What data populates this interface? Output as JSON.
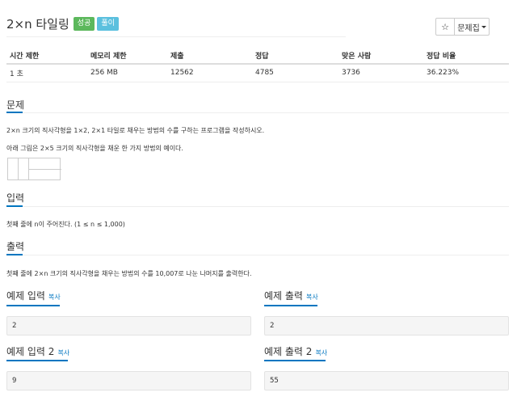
{
  "problem": {
    "title": "2×n 타일링",
    "badges": [
      "성공",
      "풀이"
    ]
  },
  "buttons": {
    "star": "☆",
    "problem_set": "문제집"
  },
  "info_table": {
    "headers": [
      "시간 제한",
      "메모리 제한",
      "제출",
      "정답",
      "맞은 사람",
      "정답 비율"
    ],
    "values": [
      "1 초",
      "256 MB",
      "12562",
      "4785",
      "3736",
      "36.223%"
    ]
  },
  "sections": {
    "problem": {
      "title": "문제",
      "lines": [
        "2×n 크기의 직사각형을 1×2, 2×1 타일로 채우는 방법의 수를 구하는 프로그램을 작성하시오.",
        "아래 그림은 2×5 크기의 직사각형을 채운 한 가지 방법의 예이다."
      ]
    },
    "input": {
      "title": "입력",
      "text": "첫째 줄에 n이 주어진다. (1 ≤ n ≤ 1,000)"
    },
    "output": {
      "title": "출력",
      "text": "첫째 줄에 2×n 크기의 직사각형을 채우는 방법의 수를 10,007로 나눈 나머지를 출력한다."
    }
  },
  "examples": {
    "copy_label": "복사",
    "input1": {
      "title": "예제 입력",
      "value": "2"
    },
    "output1": {
      "title": "예제 출력",
      "value": "2"
    },
    "input2": {
      "title": "예제 입력 2",
      "value": "9"
    },
    "output2": {
      "title": "예제 출력 2",
      "value": "55"
    }
  }
}
